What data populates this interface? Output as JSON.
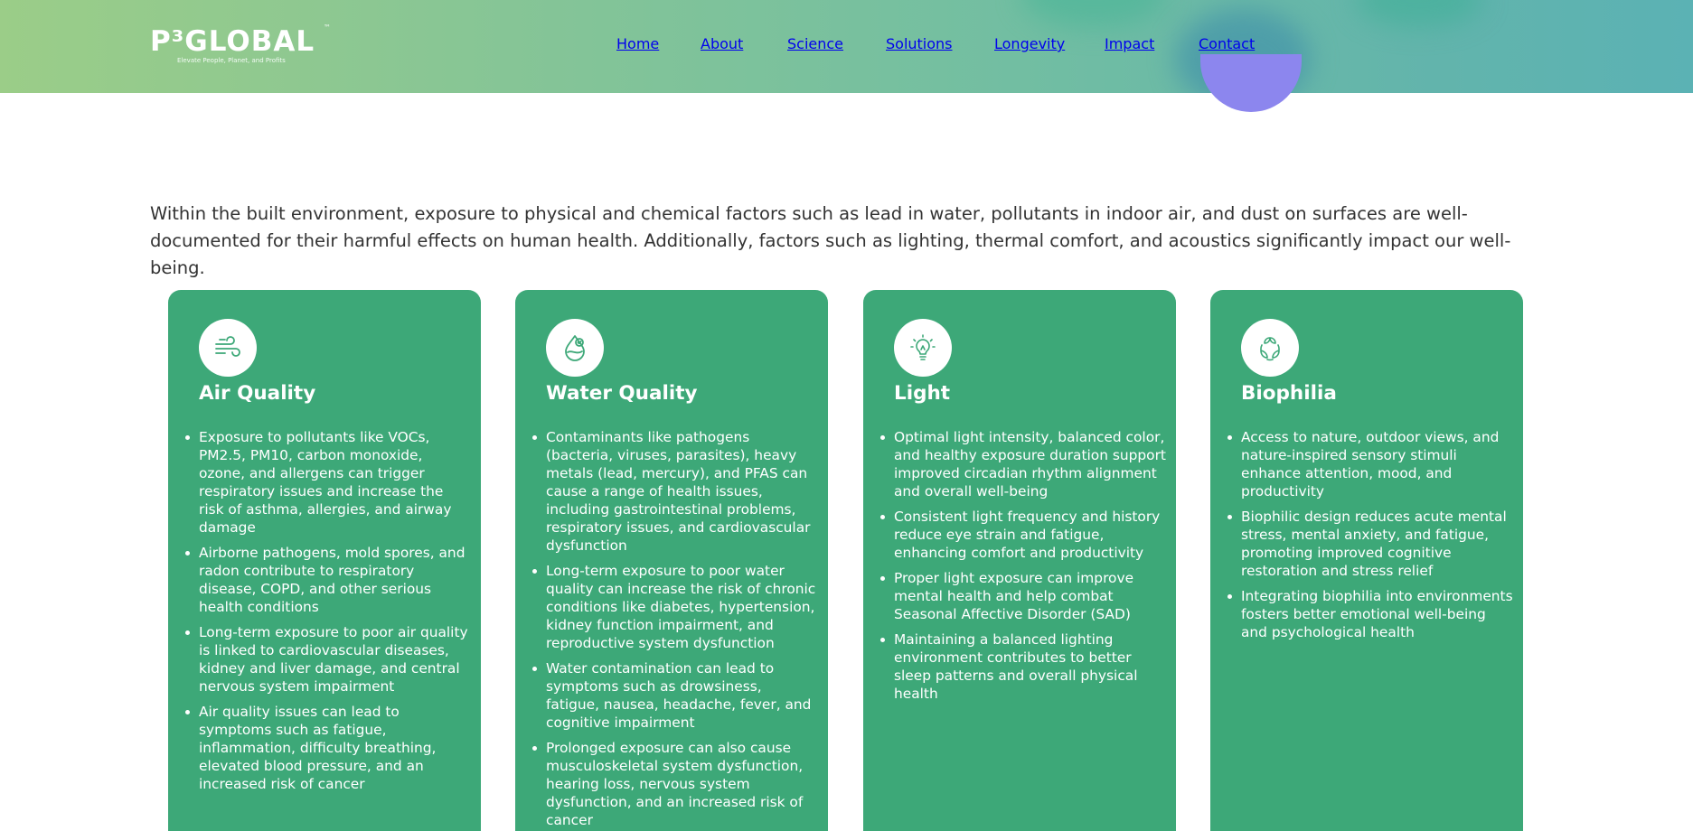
{
  "colors": {
    "header_gradient_start": "#9bcd88",
    "header_gradient_end": "#5bb2b4",
    "card_background": "#3da878",
    "accent_purple": "#8c86ee",
    "icon_stroke": "#3da878"
  },
  "brand": {
    "logo_text": "P³GLOBAL",
    "trademark": "™",
    "tagline": "Elevate People, Planet, and Profits"
  },
  "nav": {
    "items": [
      {
        "label": "Home"
      },
      {
        "label": "About"
      },
      {
        "label": "Science"
      },
      {
        "label": "Solutions"
      },
      {
        "label": "Longevity"
      },
      {
        "label": "Impact"
      },
      {
        "label": "Contact"
      }
    ]
  },
  "intro": {
    "text": "Within the built environment, exposure to physical and chemical factors such as lead in water, pollutants in indoor air, and dust on surfaces are well-documented for their harmful effects on human health. Additionally, factors such as lighting, thermal comfort, and acoustics significantly impact our well-being."
  },
  "cards": [
    {
      "icon": "wind-icon",
      "title": "Air Quality",
      "bullets": [
        "Exposure to pollutants like VOCs, PM2.5, PM10, carbon monoxide, ozone, and allergens can trigger respiratory issues and increase the risk of asthma, allergies, and airway damage",
        "Airborne pathogens, mold spores, and radon contribute to respiratory disease, COPD, and other serious health conditions",
        "Long-term exposure to poor air quality is linked to cardiovascular diseases, kidney and liver damage, and central nervous system impairment",
        "Air quality issues can lead to symptoms such as fatigue, inflammation, difficulty breathing, elevated blood pressure, and an increased risk of cancer"
      ]
    },
    {
      "icon": "water-drop-icon",
      "title": "Water Quality",
      "bullets": [
        "Contaminants like pathogens (bacteria, viruses, parasites), heavy metals (lead, mercury), and PFAS can cause a range of health issues, including gastrointestinal problems, respiratory issues, and cardiovascular dysfunction",
        "Long-term exposure to poor water quality can increase the risk of chronic conditions like diabetes, hypertension, kidney function impairment, and reproductive system dysfunction",
        "Water contamination can lead to symptoms such as drowsiness, fatigue, nausea, headache, fever, and cognitive impairment",
        "Prolonged exposure can also cause musculoskeletal system dysfunction, hearing loss, nervous system dysfunction, and an increased risk of cancer"
      ]
    },
    {
      "icon": "lightbulb-icon",
      "title": "Light",
      "bullets": [
        "Optimal light intensity, balanced color, and healthy exposure duration support improved circadian rhythm alignment and overall well-being",
        "Consistent light frequency and history reduce eye strain and fatigue, enhancing comfort and productivity",
        "Proper light exposure can improve mental health and help combat Seasonal Affective Disorder (SAD)",
        "Maintaining a balanced lighting environment contributes to better sleep patterns and overall physical health"
      ]
    },
    {
      "icon": "leaves-cycle-icon",
      "title": "Biophilia",
      "bullets": [
        "Access to nature, outdoor views, and nature-inspired sensory stimuli enhance attention, mood, and productivity",
        "Biophilic design reduces acute mental stress, mental anxiety, and fatigue, promoting improved cognitive restoration and stress relief",
        "Integrating biophilia into environments fosters better emotional well-being and psychological health"
      ]
    }
  ]
}
